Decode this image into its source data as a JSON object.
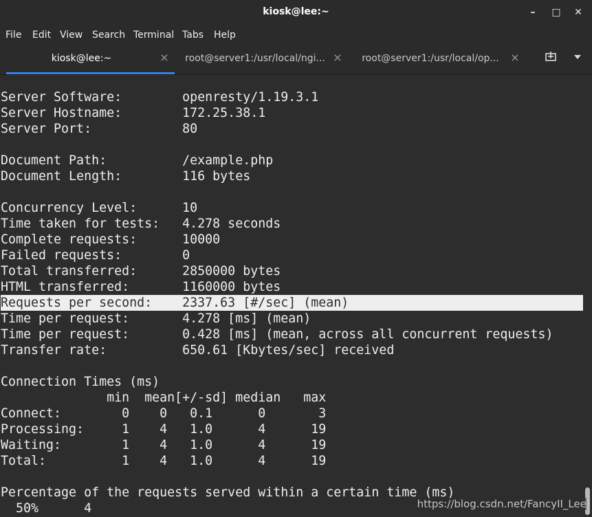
{
  "window": {
    "title": "kiosk@lee:~",
    "controls": [
      "minimize-icon",
      "maximize-icon",
      "close-icon"
    ]
  },
  "menu": [
    "File",
    "Edit",
    "View",
    "Search",
    "Terminal",
    "Tabs",
    "Help"
  ],
  "tabs": [
    {
      "label": "kiosk@lee:~",
      "active": true
    },
    {
      "label": "root@server1:/usr/local/ngi...",
      "active": false
    },
    {
      "label": "root@server1:/usr/local/op...",
      "active": false
    }
  ],
  "tab_tools": [
    "new-tab-icon",
    "tab-menu-icon"
  ],
  "terminal": {
    "lines": [
      "Server Software:        openresty/1.19.3.1",
      "Server Hostname:        172.25.38.1",
      "Server Port:            80",
      "",
      "Document Path:          /example.php",
      "Document Length:        116 bytes",
      "",
      "Concurrency Level:      10",
      "Time taken for tests:   4.278 seconds",
      "Complete requests:      10000",
      "Failed requests:        0",
      "Total transferred:      2850000 bytes",
      "HTML transferred:       1160000 bytes",
      "Requests per second:    2337.63 [#/sec] (mean)",
      "Time per request:       4.278 [ms] (mean)",
      "Time per request:       0.428 [ms] (mean, across all concurrent requests)",
      "Transfer rate:          650.61 [Kbytes/sec] received",
      "",
      "Connection Times (ms)",
      "              min  mean[+/-sd] median   max",
      "Connect:        0    0   0.1      0       3",
      "Processing:     1    4   1.0      4      19",
      "Waiting:        1    4   1.0      4      19",
      "Total:          1    4   1.0      4      19",
      "",
      "Percentage of the requests served within a certain time (ms)",
      "  50%      4"
    ],
    "highlighted_line": 13
  },
  "watermark": "https://blog.csdn.net/FancyII_Lee",
  "colors": {
    "background": "#2d2d2d",
    "foreground": "#eeeeec",
    "accent": "#3584e4"
  }
}
